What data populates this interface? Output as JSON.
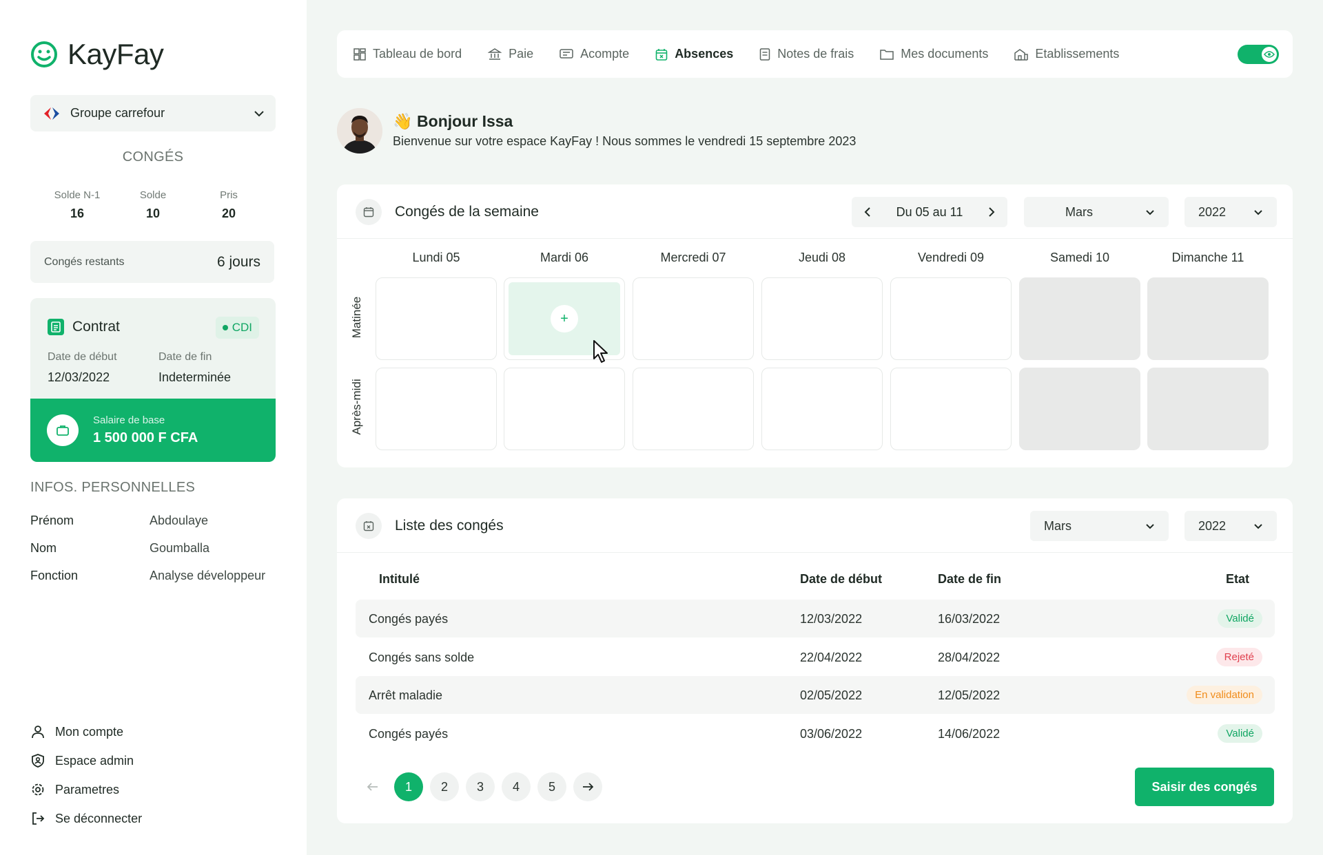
{
  "app": {
    "name": "KayFay"
  },
  "sidebar": {
    "company": "Groupe carrefour",
    "conges_title": "CONGÉS",
    "stats": [
      {
        "label": "Solde N-1",
        "value": "16"
      },
      {
        "label": "Solde",
        "value": "10"
      },
      {
        "label": "Pris",
        "value": "20"
      }
    ],
    "remaining": {
      "label": "Congés restants",
      "value": "6 jours"
    },
    "contract": {
      "title": "Contrat",
      "badge": "CDI",
      "start_label": "Date de début",
      "start_value": "12/03/2022",
      "end_label": "Date de fin",
      "end_value": "Indeterminée",
      "salary_label": "Salaire de base",
      "salary_value": "1 500 000 F CFA"
    },
    "infos_title": "INFOS. PERSONNELLES",
    "infos": [
      {
        "key": "Prénom",
        "value": "Abdoulaye"
      },
      {
        "key": "Nom",
        "value": "Goumballa"
      },
      {
        "key": "Fonction",
        "value": "Analyse développeur"
      }
    ],
    "menu": [
      {
        "label": "Mon compte",
        "icon": "user-icon"
      },
      {
        "label": "Espace admin",
        "icon": "shield-user-icon"
      },
      {
        "label": "Parametres",
        "icon": "gear-icon"
      },
      {
        "label": "Se déconnecter",
        "icon": "logout-icon"
      }
    ]
  },
  "nav": {
    "items": [
      {
        "label": "Tableau de bord",
        "icon": "dashboard-icon"
      },
      {
        "label": "Paie",
        "icon": "bank-icon"
      },
      {
        "label": "Acompte",
        "icon": "receipt-icon"
      },
      {
        "label": "Absences",
        "icon": "calendar-x-icon",
        "active": true
      },
      {
        "label": "Notes de frais",
        "icon": "notes-icon"
      },
      {
        "label": "Mes documents",
        "icon": "folder-icon"
      },
      {
        "label": "Etablissements",
        "icon": "building-icon"
      }
    ]
  },
  "greeting": {
    "emoji": "👋",
    "title": "Bonjour Issa",
    "subtitle": "Bienvenue sur votre espace KayFay ! Nous sommes le vendredi 15 septembre 2023"
  },
  "week": {
    "title": "Congés de la semaine",
    "range": "Du 05 au 11",
    "month": "Mars",
    "year": "2022",
    "days": [
      "Lundi 05",
      "Mardi 06",
      "Mercredi 07",
      "Jeudi 08",
      "Vendredi 09",
      "Samedi 10",
      "Dimanche 11"
    ],
    "rows": [
      "Matinée",
      "Après-midi"
    ],
    "plus": "+"
  },
  "list": {
    "title": "Liste des congés",
    "month": "Mars",
    "year": "2022",
    "headers": {
      "name": "Intitulé",
      "start": "Date de début",
      "end": "Date de fin",
      "state": "Etat"
    },
    "rows": [
      {
        "name": "Congés payés",
        "start": "12/03/2022",
        "end": "16/03/2022",
        "state": "Validé"
      },
      {
        "name": "Congés sans solde",
        "start": "22/04/2022",
        "end": "28/04/2022",
        "state": "Rejeté"
      },
      {
        "name": "Arrêt maladie",
        "start": "02/05/2022",
        "end": "12/05/2022",
        "state": "En validation"
      },
      {
        "name": "Congés payés",
        "start": "03/06/2022",
        "end": "14/06/2022",
        "state": "Validé"
      }
    ],
    "pages": [
      "1",
      "2",
      "3",
      "4",
      "5"
    ],
    "cta": "Saisir des congés"
  },
  "colors": {
    "accent": "#10b26b",
    "danger": "#e0414f",
    "warning": "#f08c1a"
  }
}
